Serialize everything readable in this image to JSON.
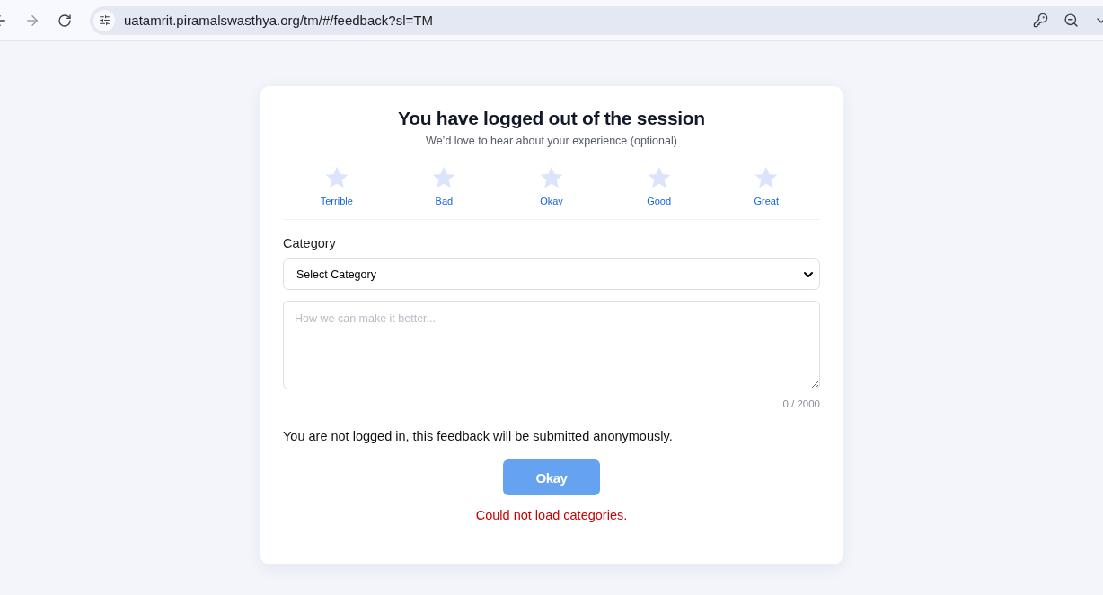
{
  "browser": {
    "url": "uatamrit.piramalswasthya.org/tm/#/feedback?sl=TM",
    "forward_disabled": true
  },
  "card": {
    "title": "You have logged out of the session",
    "subtitle": "We’d love to hear about your experience (optional)",
    "rating": {
      "stars": 0,
      "labels": [
        "Terrible",
        "Bad",
        "Okay",
        "Good",
        "Great"
      ]
    },
    "category": {
      "label": "Category",
      "value": "Select Category"
    },
    "comment": {
      "placeholder": "How we can make it better...",
      "counter": "0 / 2000"
    },
    "notice": "You are not logged in, this feedback will be submitted anonymously.",
    "submit": {
      "label": "Okay",
      "disabled": true
    },
    "error": "Could not load categories."
  }
}
